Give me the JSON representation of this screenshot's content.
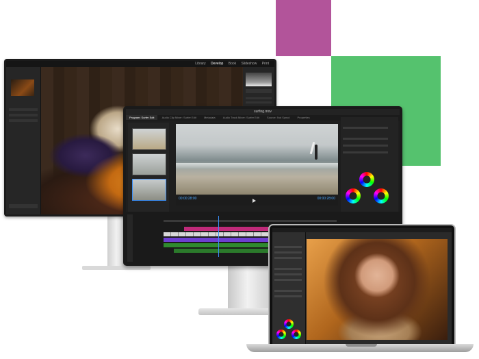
{
  "colors": {
    "magenta_block": "#b2549a",
    "green_block": "#55c26e",
    "accent_blue": "#3a8ef6"
  },
  "back_monitor": {
    "menu": [
      "Library",
      "Develop",
      "Book",
      "Slideshow",
      "Print"
    ],
    "active_module": "Develop"
  },
  "front_monitor": {
    "window_title": "surfing.mov",
    "tabs": [
      "Program: Surfer Edit",
      "Audio Clip Mixer: Surfer Edit",
      "Metadata",
      "Audio Track Mixer: Surfer Edit",
      "Source: Not Syncd",
      "Properties"
    ],
    "timecode_left": "00:00:28:00",
    "timecode_right": "00:00:28:00"
  },
  "icons": [
    "close-icon",
    "play-icon",
    "color-wheel-icon"
  ]
}
